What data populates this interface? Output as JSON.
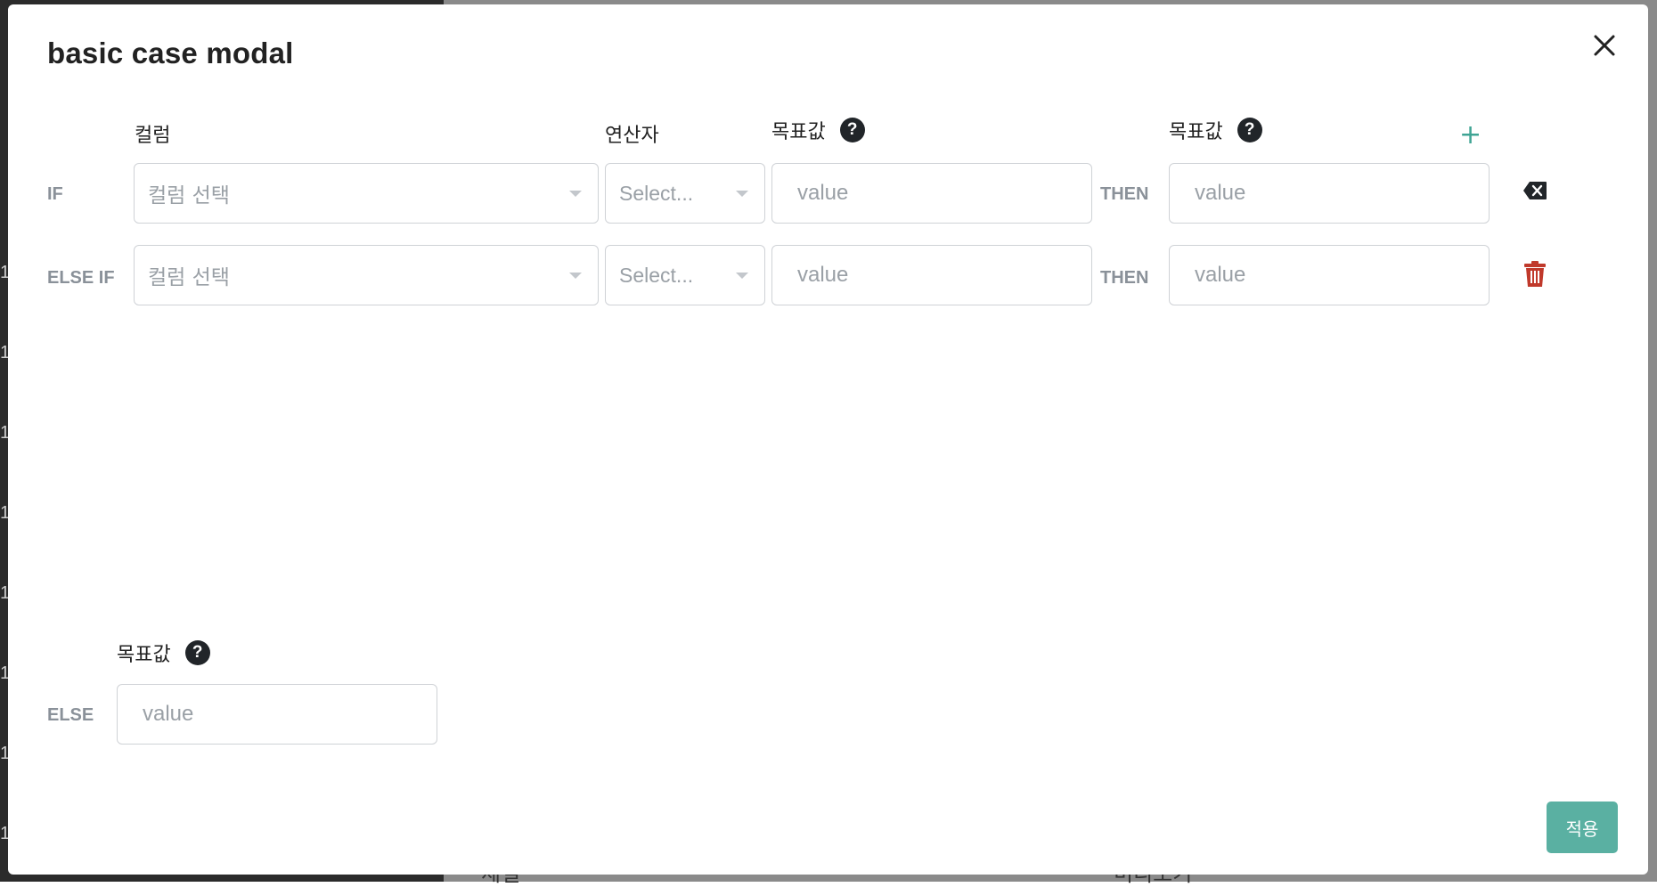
{
  "background": {
    "row_numbers": [
      "1",
      "1",
      "1",
      "1",
      "1",
      "1",
      "1",
      "1"
    ],
    "bottom_left_text": "체널",
    "bottom_right_text": "미리보기"
  },
  "modal": {
    "title": "basic case modal",
    "headers": {
      "column": "컬럼",
      "operator": "연산자",
      "target_value": "목표값",
      "then_value": "목표값",
      "else_value": "목표값",
      "help_glyph": "?"
    },
    "add_glyph": "+",
    "rows": [
      {
        "label": "IF",
        "column_placeholder": "컬럼 선택",
        "operator_placeholder": "Select...",
        "value_placeholder": "value",
        "then_label": "THEN",
        "then_placeholder": "value",
        "action_icon": "backspace-icon"
      },
      {
        "label": "ELSE IF",
        "column_placeholder": "컬럼 선택",
        "operator_placeholder": "Select...",
        "value_placeholder": "value",
        "then_label": "THEN",
        "then_placeholder": "value",
        "action_icon": "trash-icon"
      }
    ],
    "else": {
      "label": "ELSE",
      "placeholder": "value"
    },
    "apply_label": "적용",
    "colors": {
      "accent": "#5ab0a2",
      "add": "#3fa494",
      "danger": "#c0392b",
      "label_gray": "#8a9199"
    }
  }
}
